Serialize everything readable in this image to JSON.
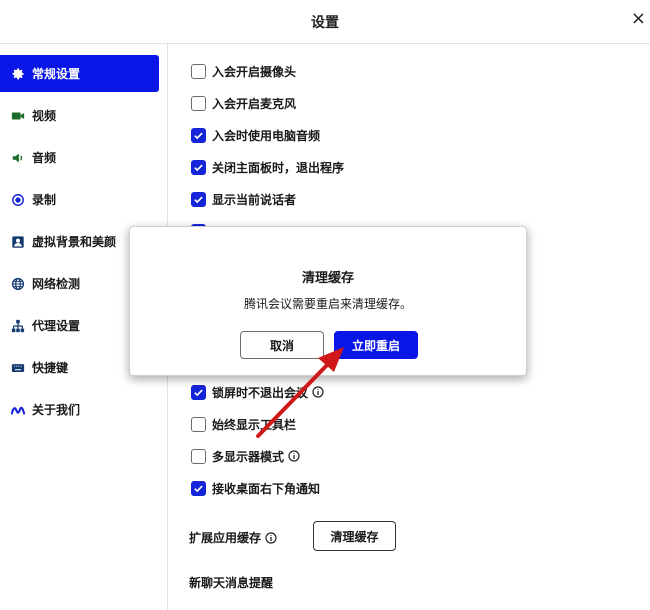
{
  "window": {
    "title": "设置",
    "close_glyph": "×"
  },
  "sidebar": {
    "items": [
      {
        "label": "常规设置",
        "icon": "gear-icon",
        "active": true
      },
      {
        "label": "视频",
        "icon": "video-icon"
      },
      {
        "label": "音频",
        "icon": "speaker-icon"
      },
      {
        "label": "录制",
        "icon": "record-icon"
      },
      {
        "label": "虚拟背景和美颜",
        "icon": "portrait-icon"
      },
      {
        "label": "网络检测",
        "icon": "globe-icon"
      },
      {
        "label": "代理设置",
        "icon": "network-icon"
      },
      {
        "label": "快捷键",
        "icon": "keyboard-icon"
      },
      {
        "label": "关于我们",
        "icon": "logo-icon"
      }
    ]
  },
  "general": {
    "options_top": [
      {
        "label": "入会开启摄像头",
        "checked": false
      },
      {
        "label": "入会开启麦克风",
        "checked": false
      },
      {
        "label": "入会时使用电脑音频",
        "checked": true
      },
      {
        "label": "关闭主面板时，退出程序",
        "checked": true
      },
      {
        "label": "显示当前说话者",
        "checked": true
      }
    ],
    "options_bottom": [
      {
        "label": "锁屏时不退出会议",
        "checked": true,
        "info": true
      },
      {
        "label": "始终显示工具栏",
        "checked": false,
        "info": false
      },
      {
        "label": "多显示器模式",
        "checked": false,
        "info": true
      },
      {
        "label": "接收桌面右下角通知",
        "checked": true,
        "info": false
      }
    ],
    "extension_cache_label": "扩展应用缓存",
    "clear_cache_button": "清理缓存",
    "chat_notify_label": "新聊天消息提醒"
  },
  "dialog": {
    "title": "清理缓存",
    "message": "腾讯会议需要重启来清理缓存。",
    "cancel_label": "取消",
    "confirm_label": "立即重启"
  },
  "colors": {
    "accent": "#0a16e6",
    "arrow": "#d01818"
  }
}
